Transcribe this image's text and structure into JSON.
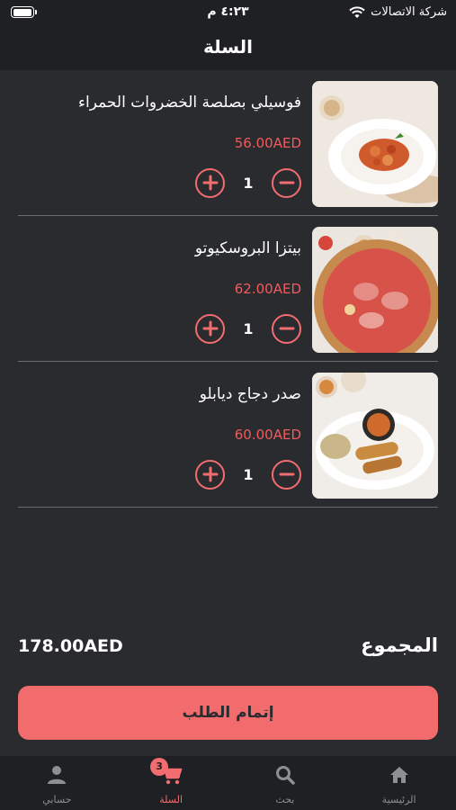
{
  "status_bar": {
    "carrier": "شركة الاتصالات",
    "time": "٤:٢٣ م",
    "battery_level": 1.0
  },
  "header": {
    "title": "السلة"
  },
  "cart_items": [
    {
      "name": "فوسيلي بصلصة الخضروات الحمراء",
      "price": "56.00AED",
      "quantity": "1",
      "image": "pasta-dish"
    },
    {
      "name": "بيتزا البروسكيوتو",
      "price": "62.00AED",
      "quantity": "1",
      "image": "pizza-dish"
    },
    {
      "name": "صدر دجاج ديابلو",
      "price": "60.00AED",
      "quantity": "1",
      "image": "chicken-dish"
    }
  ],
  "total": {
    "label": "المجموع",
    "amount": "178.00AED"
  },
  "checkout": {
    "label": "إتمام الطلب"
  },
  "tabs": [
    {
      "label": "الرئيسية",
      "icon": "home-icon",
      "active": false
    },
    {
      "label": "بحث",
      "icon": "search-icon",
      "active": false
    },
    {
      "label": "السلة",
      "icon": "cart-icon",
      "active": true,
      "badge": "3"
    },
    {
      "label": "حسابي",
      "icon": "person-icon",
      "active": false
    }
  ],
  "colors": {
    "accent": "#f26c70",
    "background": "#2a2b2e",
    "bar": "#1f2023",
    "price": "#f15b5d"
  }
}
